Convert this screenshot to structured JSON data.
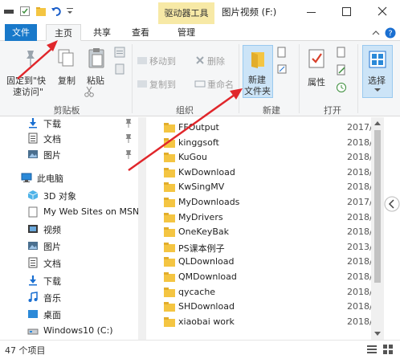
{
  "window": {
    "context_tab": "驱动器工具",
    "title": "图片视频 (F:)",
    "minimize_label": "—",
    "maximize_label": "☐",
    "close_label": "✕"
  },
  "tabs": [
    {
      "label": "文件"
    },
    {
      "label": "主页"
    },
    {
      "label": "共享"
    },
    {
      "label": "查看"
    },
    {
      "label": "管理"
    }
  ],
  "ribbon": {
    "clipboard": {
      "pin_label_1": "固定到\"快",
      "pin_label_2": "速访问\"",
      "copy_label": "复制",
      "paste_label": "粘贴",
      "group_label": "剪贴板"
    },
    "organize": {
      "move_to": "移动到",
      "copy_to": "复制到",
      "delete": "删除",
      "rename": "重命名",
      "group_label": "组织"
    },
    "new": {
      "new_folder_1": "新建",
      "new_folder_2": "文件夹",
      "group_label": "新建"
    },
    "open": {
      "properties": "属性",
      "group_label": "打开"
    },
    "select": {
      "select_label": "选择"
    }
  },
  "nav": {
    "items": [
      {
        "label": "下载",
        "icon": "download-icon",
        "pinned": true
      },
      {
        "label": "文档",
        "icon": "documents-icon",
        "pinned": true
      },
      {
        "label": "图片",
        "icon": "pictures-icon",
        "pinned": true
      },
      {
        "label": "此电脑",
        "icon": "pc-icon",
        "pinned": false
      },
      {
        "label": "3D 对象",
        "icon": "3d-objects-icon",
        "pinned": false
      },
      {
        "label": "My Web Sites on MSN",
        "icon": "page-icon",
        "pinned": false
      },
      {
        "label": "视频",
        "icon": "videos-icon",
        "pinned": false
      },
      {
        "label": "图片",
        "icon": "pictures-icon",
        "pinned": false
      },
      {
        "label": "文档",
        "icon": "documents-icon",
        "pinned": false
      },
      {
        "label": "下载",
        "icon": "download-icon",
        "pinned": false
      },
      {
        "label": "音乐",
        "icon": "music-icon",
        "pinned": false
      },
      {
        "label": "桌面",
        "icon": "desktop-icon",
        "pinned": false
      },
      {
        "label": "Windows10 (C:)",
        "icon": "drive-icon",
        "pinned": false
      }
    ]
  },
  "files": [
    {
      "name": "FFOutput",
      "date": "2017/"
    },
    {
      "name": "kinggsoft",
      "date": "2018/"
    },
    {
      "name": "KuGou",
      "date": "2018/"
    },
    {
      "name": "KwDownload",
      "date": "2018/"
    },
    {
      "name": "KwSingMV",
      "date": "2018/"
    },
    {
      "name": "MyDownloads",
      "date": "2017/"
    },
    {
      "name": "MyDrivers",
      "date": "2018/"
    },
    {
      "name": "OneKeyBak",
      "date": "2018/"
    },
    {
      "name": "PS课本例子",
      "date": "2013/"
    },
    {
      "name": "QLDownload",
      "date": "2018/"
    },
    {
      "name": "QMDownload",
      "date": "2018/"
    },
    {
      "name": "qycache",
      "date": "2018/"
    },
    {
      "name": "SHDownload",
      "date": "2018/"
    },
    {
      "name": "xiaobai work",
      "date": "2018/"
    }
  ],
  "status": {
    "count": "47 个项目"
  },
  "colors": {
    "file_tab": "#1979ca",
    "selection": "#cce4f7",
    "context_tab": "#f7e9a6",
    "arrow": "#e0262b",
    "folder": "#f4c542"
  }
}
